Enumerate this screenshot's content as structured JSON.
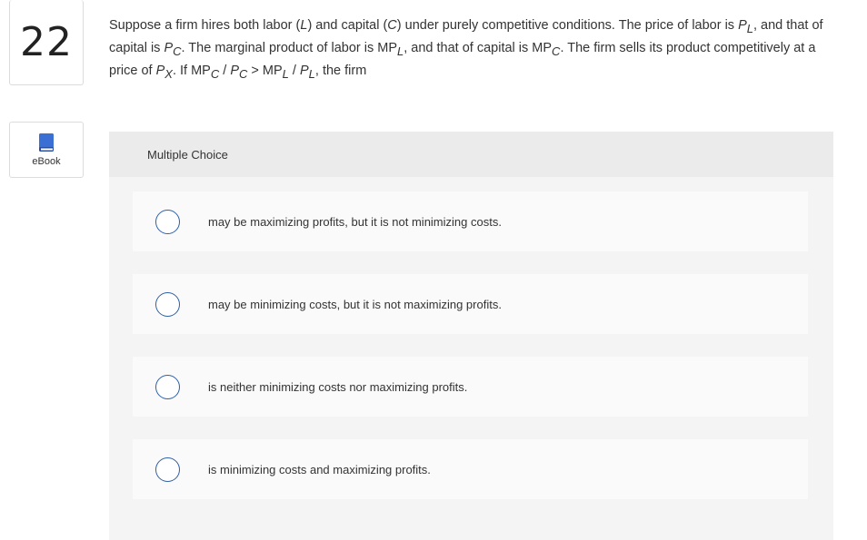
{
  "question_number": "22",
  "ebook": {
    "label": "eBook",
    "icon": "book-icon",
    "icon_color": "#3b6fd4"
  },
  "question": {
    "p1": "Suppose a firm hires both labor (",
    "L": "L",
    "p2": ") and capital (",
    "C": "C",
    "p3": ") under purely competitive conditions. The price of labor is ",
    "P": "P",
    "sub_L": "L",
    "p4": ", and that of capital is ",
    "sub_C": "C",
    "p5": ". The marginal product of labor is MP",
    "p6": ", and that of capital is MP",
    "p7": ". The firm sells its product competitively at a price of ",
    "sub_X": "X",
    "p8": ". If MP",
    "slash": " / ",
    "gt": " > MP",
    "end": ", the firm"
  },
  "multiple_choice": {
    "header": "Multiple Choice",
    "options": [
      "may be maximizing profits, but it is not minimizing costs.",
      "may be minimizing costs, but it is not maximizing profits.",
      "is neither minimizing costs nor maximizing profits.",
      "is minimizing costs and maximizing profits."
    ]
  },
  "colors": {
    "radio_border": "#2d5fa8",
    "panel_bg": "#f4f4f4",
    "header_bg": "#ebebeb",
    "option_bg": "#fafafa"
  }
}
